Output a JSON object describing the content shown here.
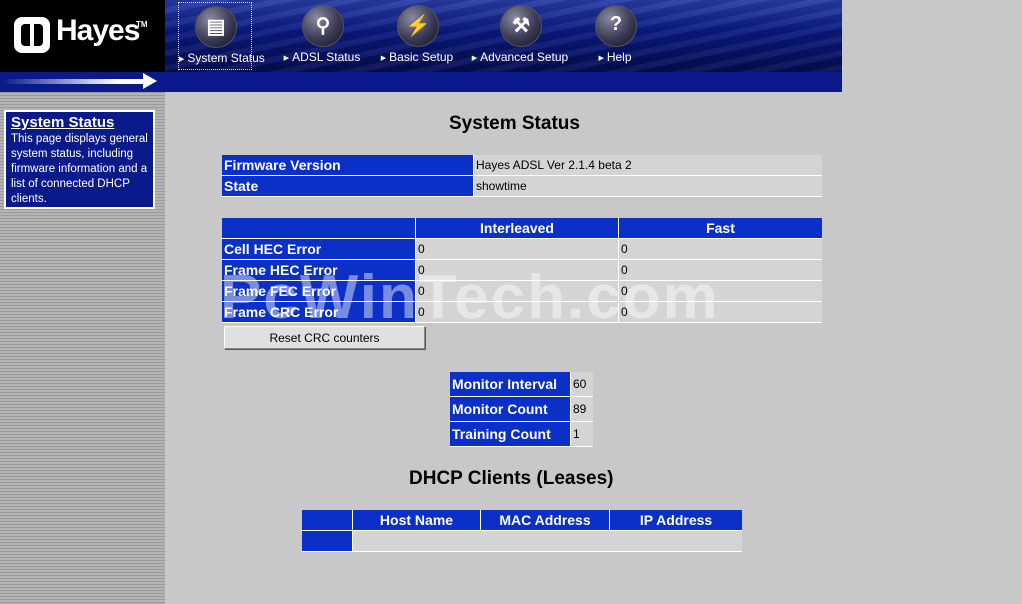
{
  "brand": {
    "name": "Hayes",
    "tm": "TM"
  },
  "nav": [
    {
      "label": "System Status",
      "icon": "folder-icon",
      "glyph": "▤"
    },
    {
      "label": "ADSL Status",
      "icon": "magnifier-icon",
      "glyph": "⚲"
    },
    {
      "label": "Basic Setup",
      "icon": "plug-icon",
      "glyph": "⚡"
    },
    {
      "label": "Advanced Setup",
      "icon": "wrench-icon",
      "glyph": "⚒"
    },
    {
      "label": "Help",
      "icon": "question-icon",
      "glyph": "?"
    }
  ],
  "sidebar": {
    "title": "System Status",
    "text": "This page displays general system status, including firmware information and a list of connected DHCP clients."
  },
  "page": {
    "title": "System Status",
    "firmware_label": "Firmware Version",
    "firmware_value": "Hayes ADSL Ver 2.1.4 beta 2",
    "state_label": "State",
    "state_value": "showtime"
  },
  "errors": {
    "col_interleaved": "Interleaved",
    "col_fast": "Fast",
    "rows": [
      {
        "label": "Cell HEC Error",
        "interleaved": "0",
        "fast": "0"
      },
      {
        "label": "Frame HEC Error",
        "interleaved": "0",
        "fast": "0"
      },
      {
        "label": "Frame FEC Error",
        "interleaved": "0",
        "fast": "0"
      },
      {
        "label": "Frame CRC Error",
        "interleaved": "0",
        "fast": "0"
      }
    ],
    "reset_label": "Reset CRC counters"
  },
  "monitor": [
    {
      "label": "Monitor Interval",
      "value": "60"
    },
    {
      "label": "Monitor Count",
      "value": "89"
    },
    {
      "label": "Training Count",
      "value": "1"
    }
  ],
  "dhcp": {
    "title": "DHCP Clients (Leases)",
    "col_host": "Host Name",
    "col_mac": "MAC Address",
    "col_ip": "IP Address"
  },
  "watermark": "PcWinTech.com"
}
